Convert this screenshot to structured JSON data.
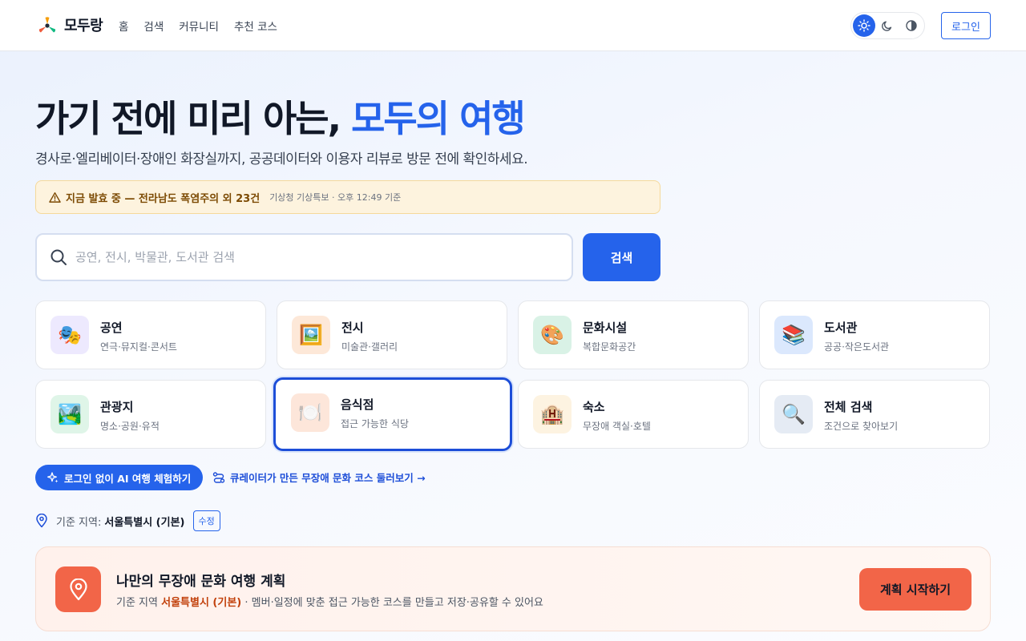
{
  "header": {
    "brand": "모두랑",
    "nav": [
      "홈",
      "검색",
      "커뮤니티",
      "추천 코스"
    ],
    "theme_options": [
      "sun-icon",
      "moon-icon",
      "contrast-icon"
    ],
    "active_theme": "light",
    "login_label": "로그인"
  },
  "hero": {
    "title_main": "가기 전에 미리 아는, ",
    "title_accent": "모두의 여행",
    "subtitle": "경사로·엘리베이터·장애인 화장실까지, 공공데이터와 이용자 리뷰로 방문 전에 확인하세요."
  },
  "alert": {
    "text": "지금 발효 중 — 전라남도 폭염주의 외 23건",
    "meta": "기상청 기상특보 · 오후 12:49 기준"
  },
  "search": {
    "placeholder": "공연, 전시, 박물관, 도서관 검색",
    "value": "",
    "button_label": "검색"
  },
  "categories": [
    {
      "title": "공연",
      "desc": "연극·뮤지컬·콘서트",
      "icon": "🎭",
      "icon_name": "performing-arts-icon",
      "bg": "#ede9fe"
    },
    {
      "title": "전시",
      "desc": "미술관·갤러리",
      "icon": "🖼️",
      "icon_name": "framed-picture-icon",
      "bg": "#fde8d8"
    },
    {
      "title": "문화시설",
      "desc": "복합문화공간",
      "icon": "🎨",
      "icon_name": "palette-icon",
      "bg": "#d9f2e6"
    },
    {
      "title": "도서관",
      "desc": "공공·작은도서관",
      "icon": "📚",
      "icon_name": "books-icon",
      "bg": "#dbe8fd"
    },
    {
      "title": "관광지",
      "desc": "명소·공원·유적",
      "icon": "🏞️",
      "icon_name": "landscape-icon",
      "bg": "#dff5e8"
    },
    {
      "title": "음식점",
      "desc": "접근 가능한 식당",
      "icon": "🍽️",
      "icon_name": "plate-icon",
      "bg": "#fde6da"
    },
    {
      "title": "숙소",
      "desc": "무장애 객실·호텔",
      "icon": "🏨",
      "icon_name": "hotel-icon",
      "bg": "#fdf3e1"
    },
    {
      "title": "전체 검색",
      "desc": "조건으로 찾아보기",
      "icon": "🔍",
      "icon_name": "magnifier-icon",
      "bg": "#e5ebf4"
    }
  ],
  "selected_category": "음식점",
  "cta": {
    "ai_label": "로그인 없이 AI 여행 체험하기",
    "course_label": "큐레이터가 만든 무장애 문화 코스 둘러보기 →"
  },
  "region": {
    "label": "기준 지역:",
    "value": "서울특별시 (기본)",
    "edit_label": "수정"
  },
  "plan": {
    "title": "나만의 무장애 문화 여행 계획",
    "desc_prefix": "기준 지역 ",
    "desc_region": "서울특별시 (기본)",
    "desc_suffix": " · 멤버·일정에 맞춘 접근 가능한 코스를 만들고 저장·공유할 수 있어요",
    "button_label": "계획 시작하기"
  },
  "colors": {
    "primary": "#2563eb",
    "accent_orange": "#f26548",
    "alert_bg": "#fdf3de"
  }
}
